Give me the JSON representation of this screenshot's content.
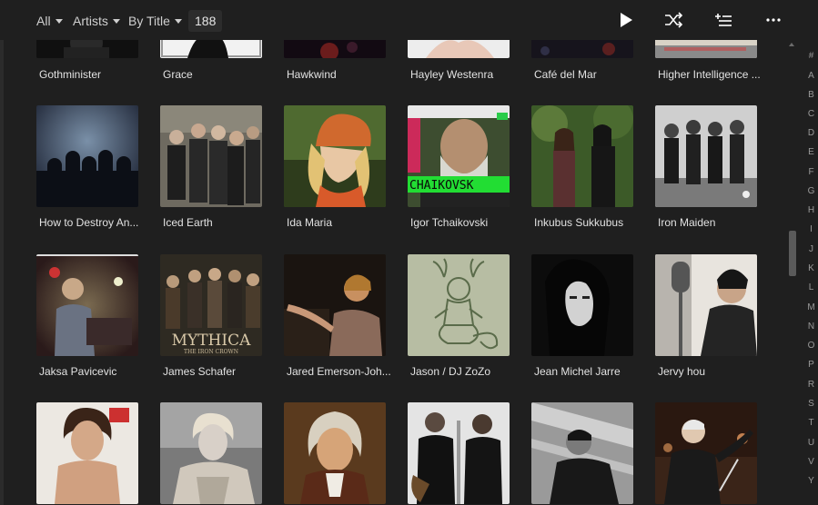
{
  "toolbar": {
    "filter_all": "All",
    "filter_type": "Artists",
    "sort": "By Title",
    "count": "188",
    "icons": [
      "play-icon",
      "shuffle-icon",
      "add-to-queue-icon",
      "more-icon"
    ]
  },
  "rows": [
    [
      "Gothminister",
      "Grace",
      "Hawkwind",
      "Hayley Westenra",
      "Café del Mar",
      "Higher Intelligence ..."
    ],
    [
      "How to Destroy An...",
      "Iced Earth",
      "Ida Maria",
      "Igor Tchaikovski",
      "Inkubus Sukkubus",
      "Iron Maiden"
    ],
    [
      "Jaksa Pavicevic",
      "James Schafer",
      "Jared Emerson-Joh...",
      "Jason / DJ ZoZo",
      "Jean Michel Jarre",
      "Jervy hou"
    ],
    [
      "",
      "",
      "",
      "",
      "",
      ""
    ]
  ],
  "art_text": {
    "tchaikovsky": "CHAIKOVSK",
    "mythica": "MYTHICA",
    "mythica_sub": "THE IRON CROWN"
  },
  "alphabet": [
    "#",
    "A",
    "B",
    "C",
    "D",
    "E",
    "F",
    "G",
    "H",
    "I",
    "J",
    "K",
    "L",
    "M",
    "N",
    "O",
    "P",
    "R",
    "S",
    "T",
    "U",
    "V",
    "Y"
  ]
}
